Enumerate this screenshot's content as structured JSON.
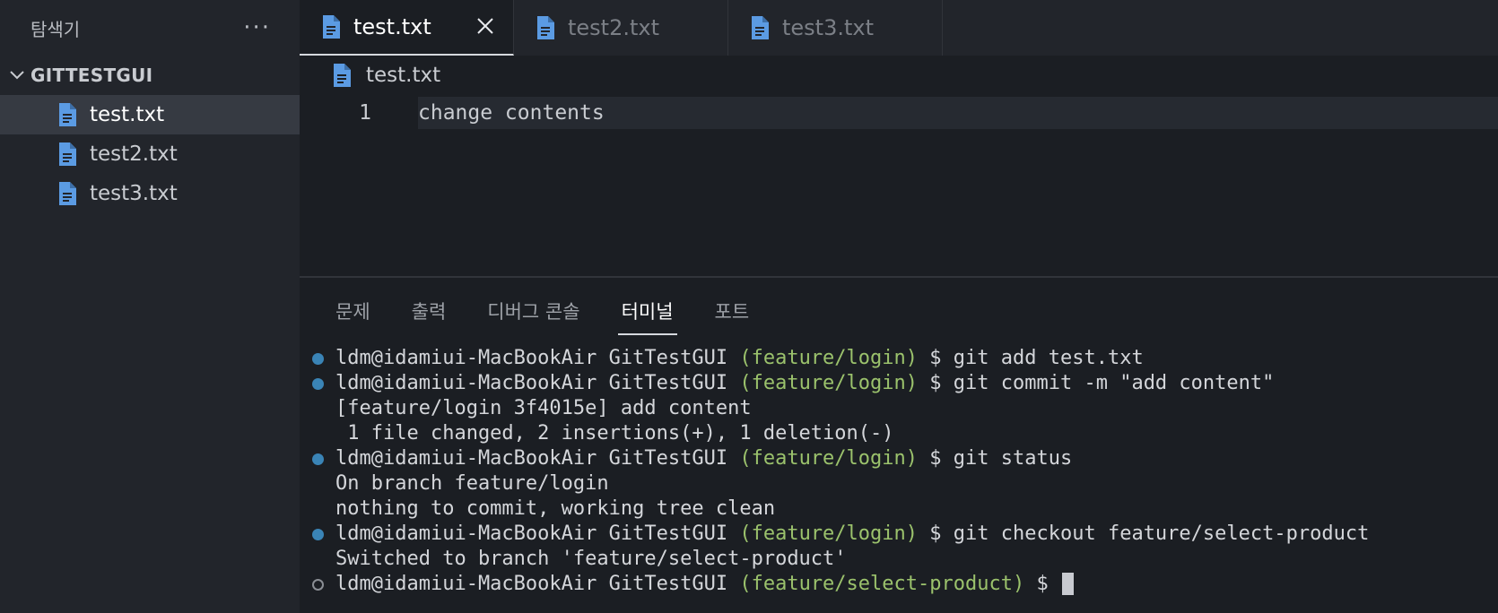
{
  "sidebar": {
    "title": "탐색기",
    "more_label": "···",
    "folder": "GITTESTGUI",
    "files": [
      "test.txt",
      "test2.txt",
      "test3.txt"
    ]
  },
  "tabs": [
    {
      "label": "test.txt",
      "active": true
    },
    {
      "label": "test2.txt",
      "active": false
    },
    {
      "label": "test3.txt",
      "active": false
    }
  ],
  "editor": {
    "breadcrumb": "test.txt",
    "line_number": "1",
    "line_text": "change contents"
  },
  "panel": {
    "tabs": [
      "문제",
      "출력",
      "디버그 콘솔",
      "터미널",
      "포트"
    ],
    "active_tab": "터미널"
  },
  "terminal": {
    "user_host": "ldm@idamiui-MacBookAir GitTestGUI ",
    "lines": [
      {
        "type": "cmd",
        "branch": "(feature/login)",
        "cmd": " $ git add test.txt"
      },
      {
        "type": "cmd",
        "branch": "(feature/login)",
        "cmd": " $ git commit -m \"add content\""
      },
      {
        "type": "out",
        "text": "[feature/login 3f4015e] add content"
      },
      {
        "type": "out",
        "text": " 1 file changed, 2 insertions(+), 1 deletion(-)"
      },
      {
        "type": "cmd",
        "branch": "(feature/login)",
        "cmd": " $ git status"
      },
      {
        "type": "out",
        "text": "On branch feature/login"
      },
      {
        "type": "out",
        "text": "nothing to commit, working tree clean"
      },
      {
        "type": "cmd",
        "branch": "(feature/login)",
        "cmd": " $ git checkout feature/select-product"
      },
      {
        "type": "out",
        "text": "Switched to branch 'feature/select-product'"
      },
      {
        "type": "prompt",
        "branch": "(feature/select-product)",
        "cmd": " $ "
      }
    ]
  },
  "colors": {
    "branch": "#9bc26c",
    "dot": "#3a84b6",
    "file_icon": "#5b9be3"
  },
  "icons": {
    "file": "file-text-icon",
    "close": "close-icon",
    "chevron": "chevron-down-icon",
    "more": "more-icon"
  }
}
